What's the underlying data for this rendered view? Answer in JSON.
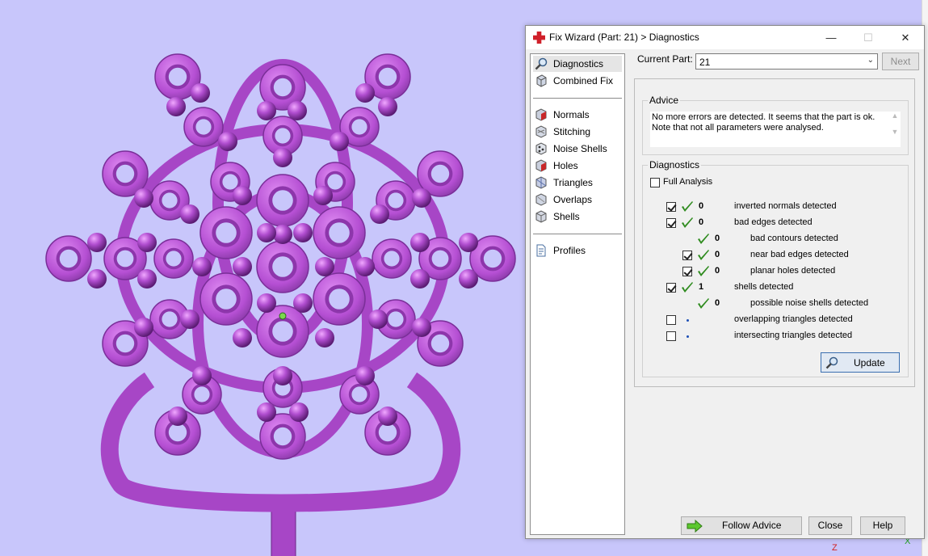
{
  "viewport": {
    "axis_label": "Z",
    "axis_x_label": "X"
  },
  "dialog": {
    "title": "Fix Wizard (Part: 21) > Diagnostics",
    "window_buttons": {
      "minimize": "—",
      "maximize": "☐",
      "close": "✕"
    },
    "nav": {
      "items": [
        {
          "label": "Diagnostics",
          "icon": "magnifier-icon",
          "selected": true
        },
        {
          "label": "Combined Fix",
          "icon": "combined-fix-icon"
        },
        {
          "label": "Normals",
          "icon": "normals-icon"
        },
        {
          "label": "Stitching",
          "icon": "stitching-icon"
        },
        {
          "label": "Noise Shells",
          "icon": "noise-shells-icon"
        },
        {
          "label": "Holes",
          "icon": "holes-icon"
        },
        {
          "label": "Triangles",
          "icon": "triangles-icon"
        },
        {
          "label": "Overlaps",
          "icon": "overlaps-icon"
        },
        {
          "label": "Shells",
          "icon": "shells-icon"
        },
        {
          "label": "Profiles",
          "icon": "profiles-icon"
        }
      ]
    },
    "current_part": {
      "label": "Current Part:",
      "value": "21"
    },
    "next_label": "Next",
    "advice": {
      "title": "Advice",
      "text": "No more errors are detected. It seems that the part is ok. Note that not all parameters were analysed."
    },
    "diagnostics": {
      "title": "Diagnostics",
      "full_analysis_label": "Full Analysis",
      "rows": [
        {
          "checkbox": "checked",
          "status": "ok",
          "count": "0",
          "label": "inverted normals detected"
        },
        {
          "checkbox": "checked",
          "status": "ok",
          "count": "0",
          "label": "bad edges detected"
        },
        {
          "checkbox": "none",
          "status": "ok",
          "count": "0",
          "label": "bad contours detected"
        },
        {
          "checkbox": "checked",
          "status": "ok",
          "count": "0",
          "label": "near bad edges detected"
        },
        {
          "checkbox": "checked",
          "status": "ok",
          "count": "0",
          "label": "planar holes detected"
        },
        {
          "checkbox": "checked",
          "status": "ok",
          "count": "1",
          "label": "shells detected"
        },
        {
          "checkbox": "none",
          "status": "ok",
          "count": "0",
          "label": "possible noise shells detected"
        },
        {
          "checkbox": "unchecked",
          "status": "pending",
          "count": "",
          "label": "overlapping triangles detected"
        },
        {
          "checkbox": "unchecked",
          "status": "pending",
          "count": "",
          "label": "intersecting triangles detected"
        }
      ],
      "update_label": "Update"
    },
    "footer": {
      "follow_advice": "Follow Advice",
      "close": "Close",
      "help": "Help"
    },
    "colors": {
      "check_green": "#2e8b1e",
      "model_purple": "#b24ed0",
      "background": "#c8c6fb"
    }
  }
}
